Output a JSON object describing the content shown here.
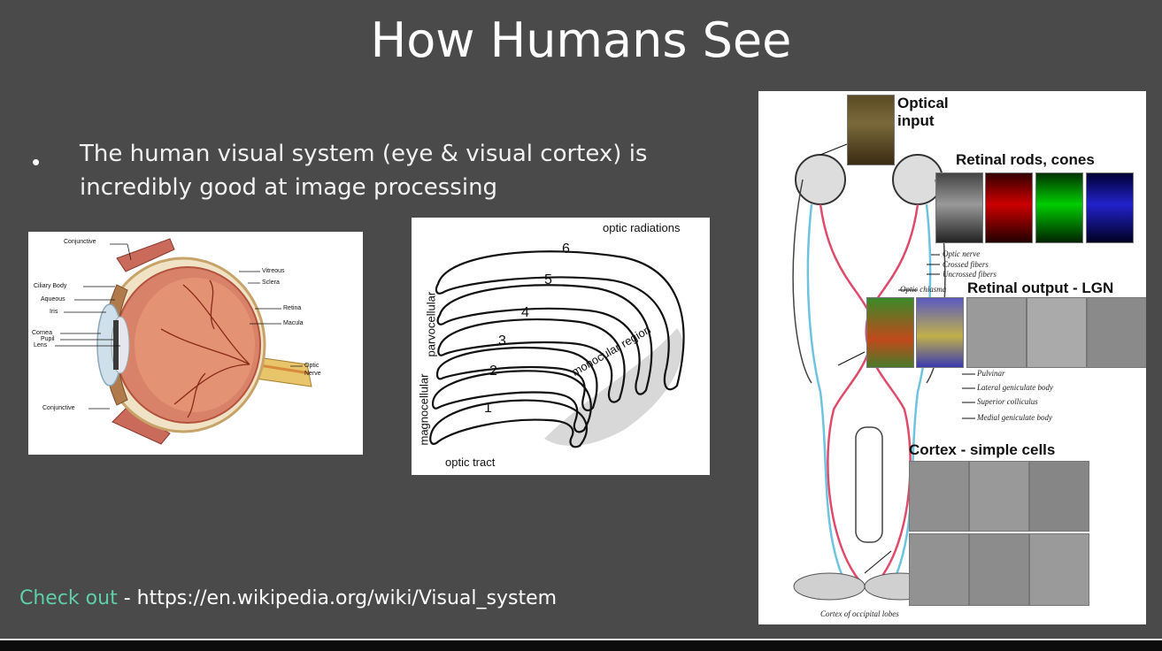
{
  "title": "How Humans See",
  "bullet": {
    "line1": "The human visual system (eye & visual cortex) is",
    "line2": "incredibly good at image processing"
  },
  "eye_diagram": {
    "labels": {
      "conjunctive_top": "Conjunctive",
      "ciliary_body": "Ciliary Body",
      "aqueous": "Aqueous",
      "iris": "Iris",
      "cornea": "Cornea",
      "pupil": "Pupil",
      "lens": "Lens",
      "conjunctive_bottom": "Conjunctive",
      "vitreous": "Vitreous",
      "sclera": "Sclera",
      "retina": "Retina",
      "macula": "Macula",
      "optic": "Optic",
      "nerve": "Nerve"
    }
  },
  "lgn_diagram": {
    "optic_radiations": "optic radiations",
    "parvocellular": "parvocellular",
    "magnocellular": "magnocellular",
    "monocular_region": "monocular region",
    "optic_tract": "optic tract",
    "layers": [
      "1",
      "2",
      "3",
      "4",
      "5",
      "6"
    ]
  },
  "visual_pathway": {
    "optical_input_1": "Optical",
    "optical_input_2": "input",
    "retinal_rods_cones": "Retinal rods, cones",
    "retinal_output": "Retinal output - LGN",
    "cortex_simple_cells": "Cortex - simple cells",
    "optic_nerve": "Optic nerve",
    "crossed_fibers": "Crossed fibers",
    "uncrossed_fibers": "Uncrossed fibers",
    "optic_chiasma": "Optic chiasma",
    "pulvinar": "Pulvinar",
    "lateral_geniculate": "Lateral geniculate body",
    "superior_colliculus": "Superior colliculus",
    "medial_geniculate": "Medial geniculate body",
    "cortex_occipital": "Cortex of occipital lobes"
  },
  "footer": {
    "check_out": "Check out",
    "dash": " - ",
    "link": "https://en.wikipedia.org/wiki/Visual_system"
  },
  "colors": {
    "slide_bg": "#4a4a4a",
    "accent_green": "#5ecfa8",
    "text_white": "#ffffff"
  }
}
